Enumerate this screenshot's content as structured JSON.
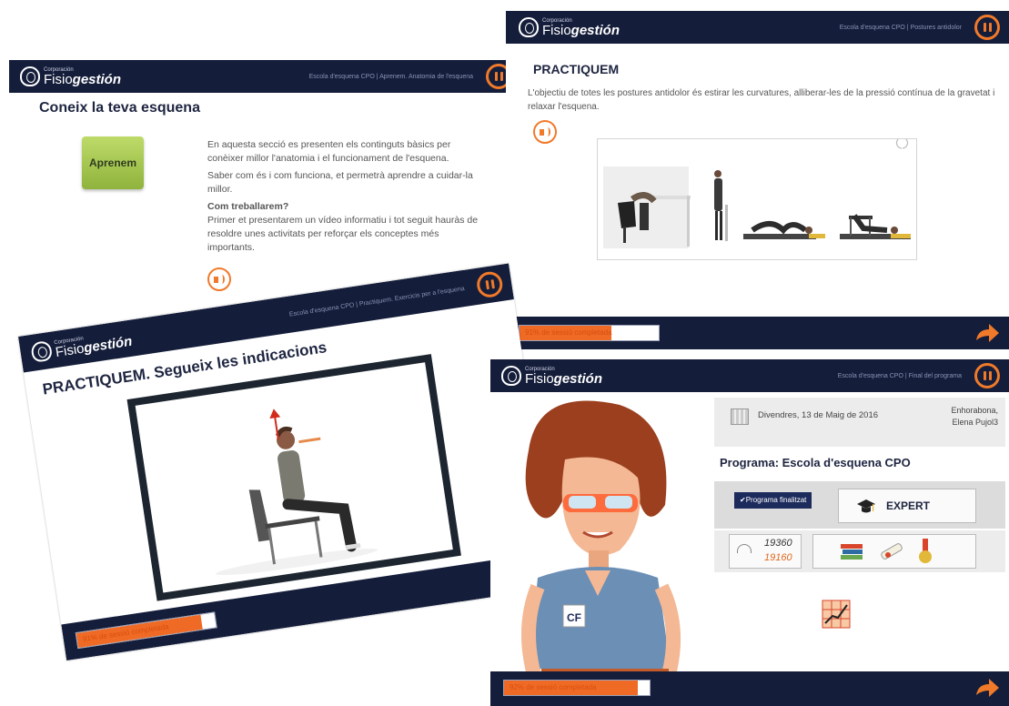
{
  "app": {
    "logo_small": "Corporación",
    "logo_main_a": "Fisio",
    "logo_main_b": "gestión"
  },
  "screen1": {
    "breadcrumb": "Escola d'esquena CPO | Aprenem. Anatomia de l'esquena",
    "title": "Coneix la teva esquena",
    "button_label": "Aprenem",
    "paragraph1": "En aquesta secció es presenten els continguts bàsics per conèixer millor l'anatomia i el funcionament de l'esquena.",
    "paragraph2": "Saber com és i com funciona, et permetrà aprendre a cuidar-la millor.",
    "subheading": "Com treballarem?",
    "paragraph3": "Primer et presentarem un vídeo informatiu i tot seguit hauràs de resoldre unes activitats per reforçar els conceptes més importants."
  },
  "screen2": {
    "breadcrumb": "Escola d'esquena CPO | Postures antidolor",
    "title": "PRACTIQUEM",
    "text": "L'objectiu de totes les postures antidolor és estirar les curvatures, alliberar-les de la pressió contínua de la gravetat i relaxar l'esquena.",
    "progress_text": "91% de sessió completada",
    "progress_value": 0.66
  },
  "screen3": {
    "breadcrumb": "Escola d'esquena CPO | Practiquem. Exercicis per a l'esquena",
    "title": "PRACTIQUEM. Segueix les indicacions",
    "progress_text": "91% de sessió completada",
    "progress_value": 0.9
  },
  "screen4": {
    "breadcrumb": "Escola d'esquena CPO | Final del programa",
    "date": "Divendres, 13 de Maig de 2016",
    "congrats_line1": "Enhorabona,",
    "congrats_line2": "Elena Pujol3",
    "program_title": "Programa: Escola d'esquena CPO",
    "finished_badge": "✔Programa finalitzat",
    "level": "EXPERT",
    "score_1": "19360",
    "score_2": "19160",
    "progress_text": "92% de sessió completada",
    "progress_value": 0.92
  },
  "colors": {
    "bar": "#141d3a",
    "accent": "#f07a2a",
    "button_green": "#a6c74d"
  },
  "icons": [
    "pause-icon",
    "audio-icon",
    "next-arrow-icon",
    "calendar-icon",
    "mortarboard-icon",
    "gauge-icon",
    "books-icon",
    "diploma-icon",
    "medal-icon",
    "chart-icon"
  ]
}
